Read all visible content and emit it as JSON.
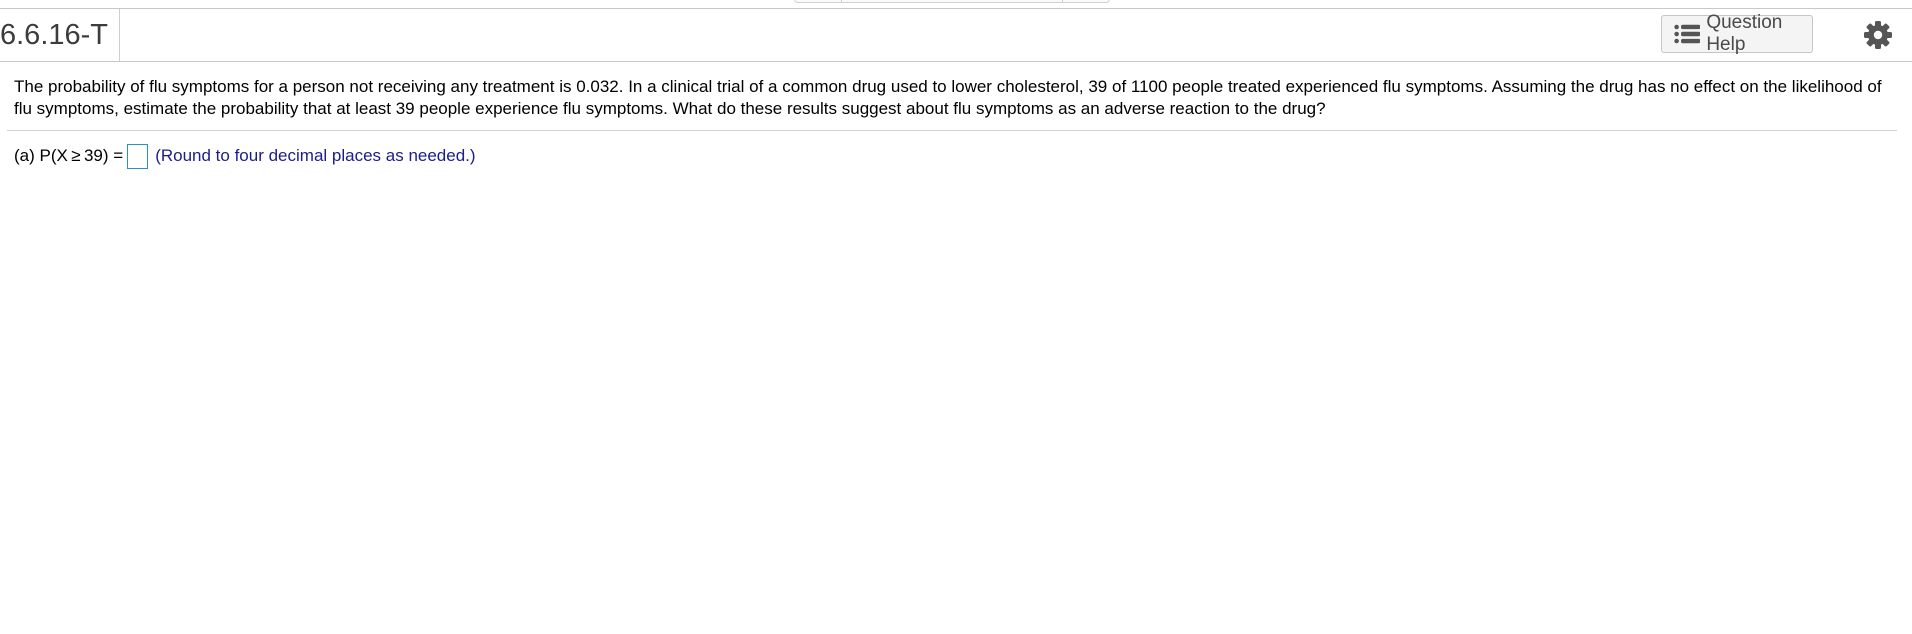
{
  "header": {
    "question_id": "6.6.16-T",
    "help_label": "Question Help"
  },
  "question": {
    "text": "The probability of flu symptoms for a person not receiving any treatment is 0.032. In a clinical trial of a common drug used to lower cholesterol, 39 of 1100 people treated experienced flu symptoms. Assuming the drug has no effect on the likelihood of flu symptoms, estimate the probability that at least 39 people experience flu symptoms. What do these results suggest about flu symptoms as an adverse reaction to the drug?"
  },
  "answer": {
    "part_label": "(a) P(X ≥ 39) =",
    "value": "",
    "hint": "(Round to four decimal places as needed.)"
  },
  "colors": {
    "hint_text": "#1c1c8c",
    "input_border": "#2e8fc1",
    "button_bg": "#f4f4f4"
  },
  "icons": {
    "help_icon": "list-icon",
    "settings_icon": "gear-icon"
  }
}
